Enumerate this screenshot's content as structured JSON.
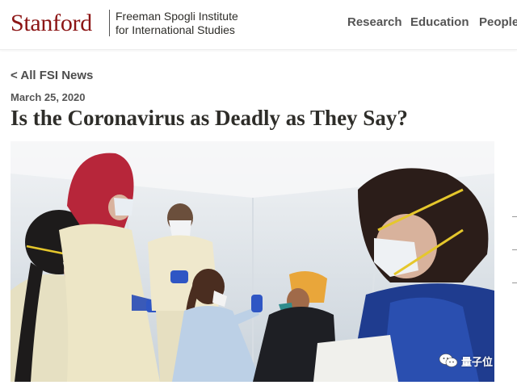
{
  "header": {
    "logo": "Stanford",
    "institute_line1": "Freeman Spogli Institute",
    "institute_line2": "for International Studies",
    "nav": [
      "Research",
      "Education",
      "People"
    ]
  },
  "article": {
    "back_link": "< All FSI News",
    "date": "March 25, 2020",
    "title": "Is the Coronavirus as Deadly as They Say?"
  },
  "watermark": {
    "text": "量子位",
    "icon": "wechat-icon"
  },
  "colors": {
    "brand_red": "#8c1515",
    "text_dark": "#2e2d29",
    "nav_gray": "#555555"
  }
}
